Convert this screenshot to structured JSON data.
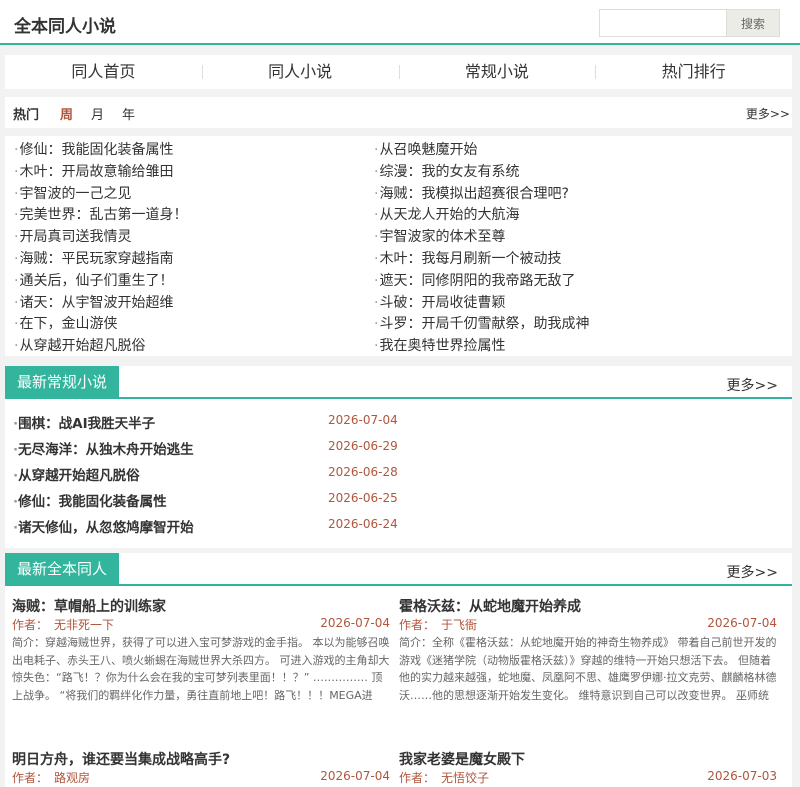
{
  "header": {
    "site_title": "全本同人小说",
    "search_placeholder": "",
    "search_button": "搜索"
  },
  "nav": [
    "同人首页",
    "同人小说",
    "常规小说",
    "热门排行"
  ],
  "hot": {
    "title": "热门",
    "tabs": [
      "周",
      "月",
      "年"
    ],
    "active_tab": "周",
    "more": "更多>>",
    "left": [
      "修仙：我能固化装备属性",
      "木叶：开局故意输给雏田",
      "宇智波的一己之见",
      "完美世界：乱古第一道身！",
      "开局真司送我情灵",
      "海贼：平民玩家穿越指南",
      "通关后，仙子们重生了！",
      "诸天：从宇智波开始超维",
      "在下，金山游侠",
      "从穿越开始超凡脱俗"
    ],
    "right": [
      "从召唤魅魔开始",
      "综漫：我的女友有系统",
      "海贼：我模拟出超赛很合理吧?",
      "从天龙人开始的大航海",
      "宇智波家的体术至尊",
      "木叶：我每月刷新一个被动技",
      "遮天：同修阴阳的我帝路无敌了",
      "斗破：开局收徒曹颖",
      "斗罗：开局千仞雪献祭，助我成神",
      "我在奥特世界捡属性"
    ]
  },
  "latest_regular": {
    "title": "最新常规小说",
    "more": "更多>>",
    "items": [
      {
        "name": "围棋：战AI我胜天半子",
        "date": "2026-07-04"
      },
      {
        "name": "无尽海洋：从独木舟开始逃生",
        "date": "2026-06-29"
      },
      {
        "name": "从穿越开始超凡脱俗",
        "date": "2026-06-28"
      },
      {
        "name": "修仙：我能固化装备属性",
        "date": "2026-06-25"
      },
      {
        "name": "诸天修仙，从忽悠鸠摩智开始",
        "date": "2026-06-24"
      }
    ]
  },
  "latest_fan": {
    "title": "最新全本同人",
    "more": "更多>>",
    "author_label": "作者：",
    "books": [
      {
        "title": "海贼：草帽船上的训练家",
        "author": "无非死一下",
        "date": "2026-07-04",
        "intro": "简介：穿越海贼世界，获得了可以进入宝可梦游戏的金手指。 本以为能够召唤出电耗子、赤头王八、喷火蜥蜴在海贼世界大杀四方。 可进入游戏的主角却大惊失色：“路飞！？你为什么会在我的宝可梦列表里面！！？” …………… 顶上战争。 “将我们的羁绊化作力量，勇往直前地上吧！路飞！！！MEGA进化！” 冠卡路飞，参见！ “全心全意，全神…"
      },
      {
        "title": "霍格沃兹：从蛇地魔开始养成",
        "author": "于飞衙",
        "date": "2026-07-04",
        "intro": "简介：全称《霍格沃兹：从蛇地魔开始的神奇生物养成》 带着自己前世开发的游戏《迷猪学院（动物版霍格沃兹）》穿越的维特一开始只想活下去。 但随着他的实力越来越强，蛇地魔、凤凰阿不思、雄鹰罗伊娜·拉文克劳、麒麟格林德沃……他的思想逐渐开始发生变化。 维特意识到自己可以改变世界。 巫师统治世界。 为了更伟大的利益。 纯血至上。 让巫师再次…"
      },
      {
        "title": "明日方舟，谁还要当集成战略高手?",
        "author": "路观房",
        "date": "2026-07-04",
        "intro": ""
      },
      {
        "title": "我家老婆是魔女殿下",
        "author": "无悟饺子",
        "date": "2026-07-03",
        "intro": ""
      }
    ]
  }
}
